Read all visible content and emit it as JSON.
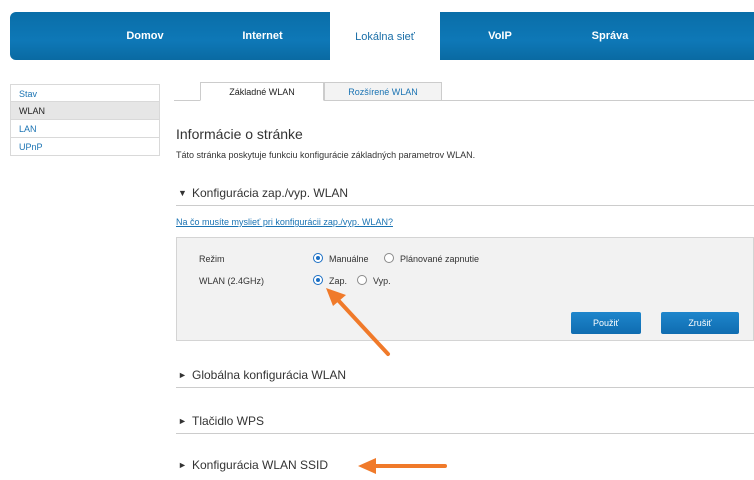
{
  "nav": {
    "items": [
      {
        "label": "Domov"
      },
      {
        "label": "Internet"
      },
      {
        "label": "Lokálna sieť"
      },
      {
        "label": "VoIP"
      },
      {
        "label": "Správa"
      }
    ]
  },
  "sidebar": {
    "items": [
      {
        "label": "Stav"
      },
      {
        "label": "WLAN"
      },
      {
        "label": "LAN"
      },
      {
        "label": "UPnP"
      }
    ]
  },
  "tabs": [
    {
      "label": "Základné WLAN"
    },
    {
      "label": "Rozšírené WLAN"
    }
  ],
  "page": {
    "title": "Informácie o stránke",
    "description": "Táto stránka poskytuje funkciu konfigurácie základných parametrov WLAN."
  },
  "sections": {
    "wlan_toggle": "Konfigurácia zap./vyp. WLAN",
    "global": "Globálna konfigurácia WLAN",
    "wps": "Tlačidlo WPS",
    "ssid": "Konfigurácia WLAN SSID"
  },
  "help_link": "Na čo musíte myslieť pri konfigurácii zap./vyp. WLAN?",
  "config": {
    "mode_label": "Režim",
    "mode_options": [
      "Manuálne",
      "Plánované zapnutie"
    ],
    "mode_selected": "Manuálne",
    "wlan_label": "WLAN (2.4GHz)",
    "wlan_options": [
      "Zap.",
      "Vyp."
    ],
    "wlan_selected": "Zap."
  },
  "buttons": {
    "apply": "Použiť",
    "cancel": "Zrušiť"
  },
  "colors": {
    "nav_blue": "#0e78b7",
    "link_blue": "#1a73b3",
    "annotation_arrow": "#f07a2a"
  }
}
